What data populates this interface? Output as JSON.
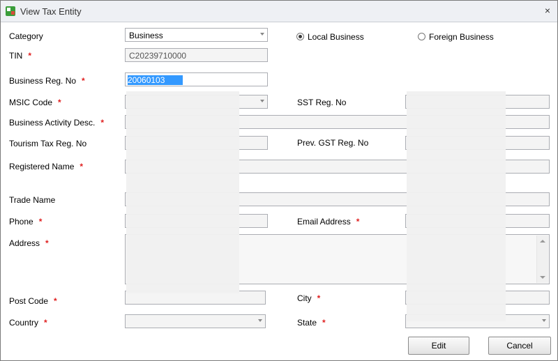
{
  "window": {
    "title": "View Tax Entity",
    "close_glyph": "×",
    "icon": "app-icon"
  },
  "labels": {
    "category": "Category",
    "tin": "TIN",
    "business_reg_no": "Business Reg. No",
    "msic_code": "MSIC Code",
    "business_activity_desc": "Business Activity Desc.",
    "tourism_tax_reg_no": "Tourism Tax Reg. No",
    "registered_name": "Registered Name",
    "trade_name": "Trade Name",
    "phone": "Phone",
    "address": "Address",
    "post_code": "Post Code",
    "country": "Country",
    "sst_reg_no": "SST Reg. No",
    "prev_gst_reg_no": "Prev. GST Reg. No",
    "email_address": "Email Address",
    "city": "City",
    "state": "State",
    "required_mark": "*"
  },
  "fields": {
    "category": "Business",
    "tin": "C20239710000",
    "business_reg_no_selected": "20060103",
    "business_reg_no_rest": "",
    "msic_code": "",
    "business_activity_desc": "",
    "tourism_tax_reg_no": "",
    "registered_name": "",
    "trade_name": "",
    "phone": "",
    "address": "",
    "post_code": "",
    "country": "",
    "sst_reg_no": "",
    "prev_gst_reg_no": "",
    "email_address": "",
    "city": "",
    "state": ""
  },
  "radios": {
    "local_business": "Local Business",
    "foreign_business": "Foreign Business",
    "selected": "local_business"
  },
  "buttons": {
    "edit": "Edit",
    "cancel": "Cancel"
  },
  "colors": {
    "required": "#e02020",
    "selection": "#3399ff"
  }
}
